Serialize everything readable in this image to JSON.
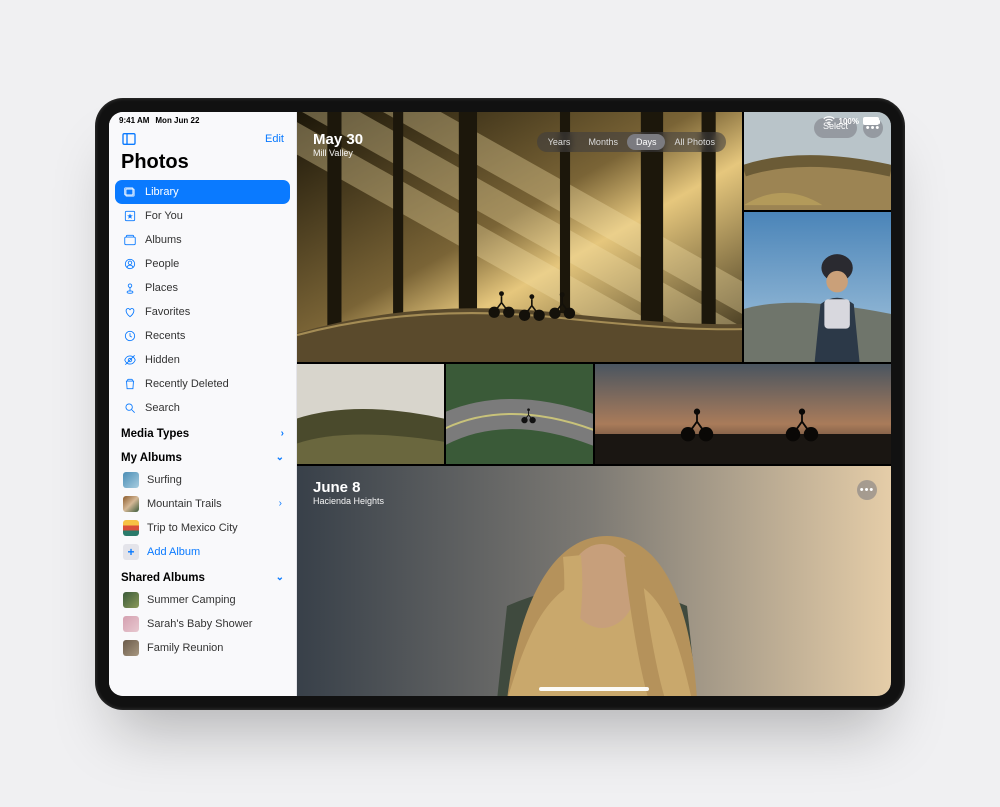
{
  "status": {
    "time": "9:41 AM",
    "date": "Mon Jun 22",
    "battery_pct": "100%"
  },
  "sidebar": {
    "edit_label": "Edit",
    "app_title": "Photos",
    "nav": [
      {
        "label": "Library",
        "icon": "photos-library-icon",
        "active": true
      },
      {
        "label": "For You",
        "icon": "for-you-icon"
      },
      {
        "label": "Albums",
        "icon": "albums-icon"
      },
      {
        "label": "People",
        "icon": "people-icon"
      },
      {
        "label": "Places",
        "icon": "places-icon"
      },
      {
        "label": "Favorites",
        "icon": "heart-icon"
      },
      {
        "label": "Recents",
        "icon": "clock-icon"
      },
      {
        "label": "Hidden",
        "icon": "eye-off-icon"
      },
      {
        "label": "Recently Deleted",
        "icon": "trash-icon"
      },
      {
        "label": "Search",
        "icon": "search-icon"
      }
    ],
    "sections": {
      "media_types": "Media Types",
      "my_albums": "My Albums",
      "shared": "Shared Albums"
    },
    "my_albums": [
      {
        "label": "Surfing"
      },
      {
        "label": "Mountain Trails",
        "disclosure": true
      },
      {
        "label": "Trip to Mexico City"
      }
    ],
    "add_album_label": "Add Album",
    "shared_albums": [
      {
        "label": "Summer Camping"
      },
      {
        "label": "Sarah's Baby Shower"
      },
      {
        "label": "Family Reunion"
      }
    ]
  },
  "main": {
    "segments": [
      "Years",
      "Months",
      "Days",
      "All Photos"
    ],
    "active_segment": "Days",
    "select_label": "Select",
    "groups": [
      {
        "date_title": "May 30",
        "location": "Mill Valley"
      },
      {
        "date_title": "June 8",
        "location": "Hacienda Heights"
      }
    ]
  }
}
